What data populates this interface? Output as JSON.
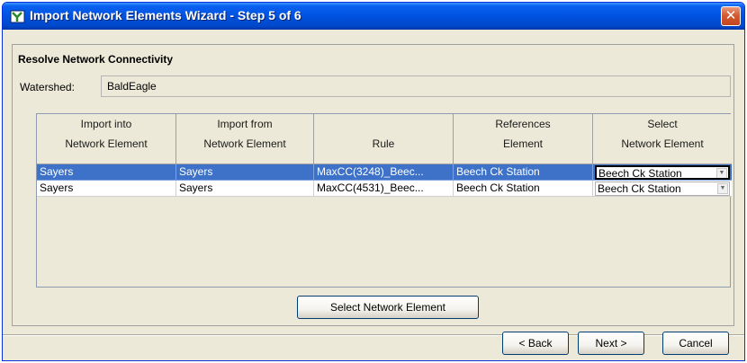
{
  "window": {
    "title": "Import Network Elements Wizard - Step 5 of 6",
    "close_label": "✕"
  },
  "section": {
    "title": "Resolve Network Connectivity"
  },
  "watershed": {
    "label": "Watershed:",
    "value": "BaldEagle"
  },
  "table": {
    "headers": [
      {
        "line1": "Import into",
        "line2": "Network Element"
      },
      {
        "line1": "Import from",
        "line2": "Network Element"
      },
      {
        "line1": "",
        "line2": "Rule"
      },
      {
        "line1": "References",
        "line2": "Element"
      },
      {
        "line1": "Select",
        "line2": "Network Element"
      }
    ],
    "rows": [
      {
        "import_into": "Sayers",
        "import_from": "Sayers",
        "rule": "MaxCC(3248)_Beec...",
        "references": "Beech Ck Station",
        "select": "Beech Ck Station",
        "selected": true
      },
      {
        "import_into": "Sayers",
        "import_from": "Sayers",
        "rule": "MaxCC(4531)_Beec...",
        "references": "Beech Ck Station",
        "select": "Beech Ck Station",
        "selected": false
      }
    ]
  },
  "buttons": {
    "select_network_element": "Select Network Element",
    "back": "< Back",
    "next": "Next >",
    "cancel": "Cancel"
  },
  "colors": {
    "selection": "#3d72c8",
    "titlebar": "#0052e0",
    "face": "#ece9d8"
  },
  "icons": {
    "title_icon": "wizard-app-icon",
    "close": "close-icon",
    "combo_arrow": "chevron-down-icon"
  }
}
